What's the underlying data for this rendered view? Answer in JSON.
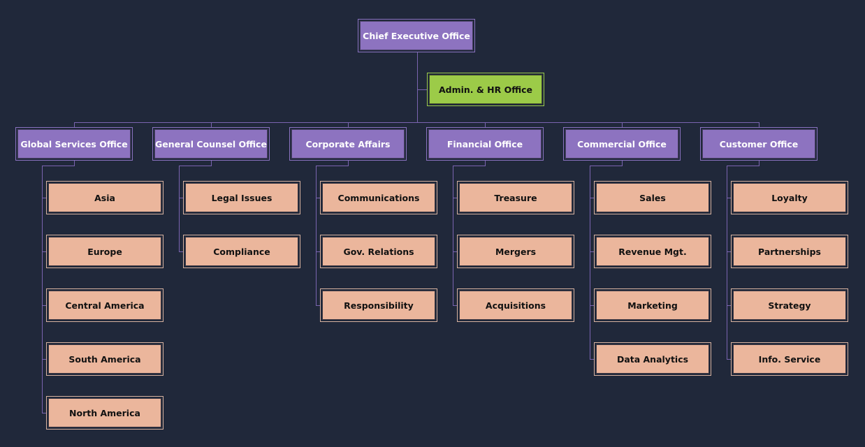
{
  "colors": {
    "background": "#20283a",
    "exec_fill": "#8d73c0",
    "admin_fill": "#9ccb48",
    "leaf_fill": "#ebb69c",
    "connector": "#7a64b0"
  },
  "org": {
    "root": {
      "label": "Chief Executive Office"
    },
    "assistant": {
      "label": "Admin. & HR Office"
    },
    "departments": [
      {
        "label": "Global Services Office",
        "children": [
          "Asia",
          "Europe",
          "Central America",
          "South America",
          "North America"
        ]
      },
      {
        "label": "General Counsel Office",
        "children": [
          "Legal Issues",
          "Compliance"
        ]
      },
      {
        "label": "Corporate Affairs",
        "children": [
          "Communications",
          "Gov. Relations",
          "Responsibility"
        ]
      },
      {
        "label": "Financial Office",
        "children": [
          "Treasure",
          "Mergers",
          "Acquisitions"
        ]
      },
      {
        "label": "Commercial Office",
        "children": [
          "Sales",
          "Revenue Mgt.",
          "Marketing",
          "Data Analytics"
        ]
      },
      {
        "label": "Customer Office",
        "children": [
          "Loyalty",
          "Partnerships",
          "Strategy",
          "Info. Service"
        ]
      }
    ]
  }
}
